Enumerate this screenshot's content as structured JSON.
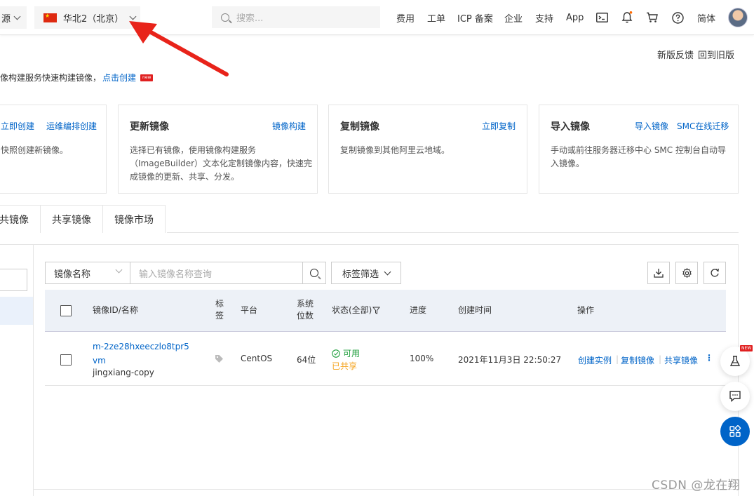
{
  "topbar": {
    "resource_label": "源",
    "region": "华北2（北京）",
    "search_placeholder": "搜索...",
    "nav": [
      "费用",
      "工单",
      "ICP 备案",
      "企业",
      "支持",
      "App"
    ],
    "lang": "简体"
  },
  "header_links": {
    "new_feedback": "新版反馈",
    "back_old": "回到旧版"
  },
  "intro": {
    "text": "像构建服务快速构建镜像，",
    "link": "点击创建",
    "badge": "new"
  },
  "cards": [
    {
      "title": "",
      "links": [
        "立即创建",
        "运维编排创建"
      ],
      "desc": "快照创建新镜像。"
    },
    {
      "title": "更新镜像",
      "links": [
        "镜像构建"
      ],
      "desc": "选择已有镜像，使用镜像构建服务（ImageBuilder）文本化定制镜像内容，快速完成镜像的更新、共享、分发。"
    },
    {
      "title": "复制镜像",
      "links": [
        "立即复制"
      ],
      "desc": "复制镜像到其他阿里云地域。"
    },
    {
      "title": "导入镜像",
      "links": [
        "导入镜像",
        "SMC在线迁移"
      ],
      "desc": "手动或前往服务器迁移中心 SMC 控制台自动导入镜像。"
    }
  ],
  "tabs": [
    "共镜像",
    "共享镜像",
    "镜像市场"
  ],
  "filter": {
    "field": "镜像名称",
    "placeholder": "输入镜像名称查询",
    "tag_filter": "标签筛选"
  },
  "table": {
    "headers": {
      "id": "镜像ID/名称",
      "tag": "标签",
      "platform": "平台",
      "bits": "系统位数",
      "status": "状态(全部)",
      "progress": "进度",
      "created": "创建时间",
      "actions": "操作"
    },
    "rows": [
      {
        "id": "m-2ze28hxeeczlo8tpr5vm",
        "name": "jingxiang-copy",
        "platform": "CentOS",
        "bits": "64位",
        "status": "可用",
        "share_status": "已共享",
        "progress": "100%",
        "created": "2021年11月3日 22:50:27",
        "actions": [
          "创建实例",
          "复制镜像",
          "共享镜像"
        ]
      }
    ]
  },
  "float_badge": "NEW",
  "watermark": "CSDN @龙在翔"
}
